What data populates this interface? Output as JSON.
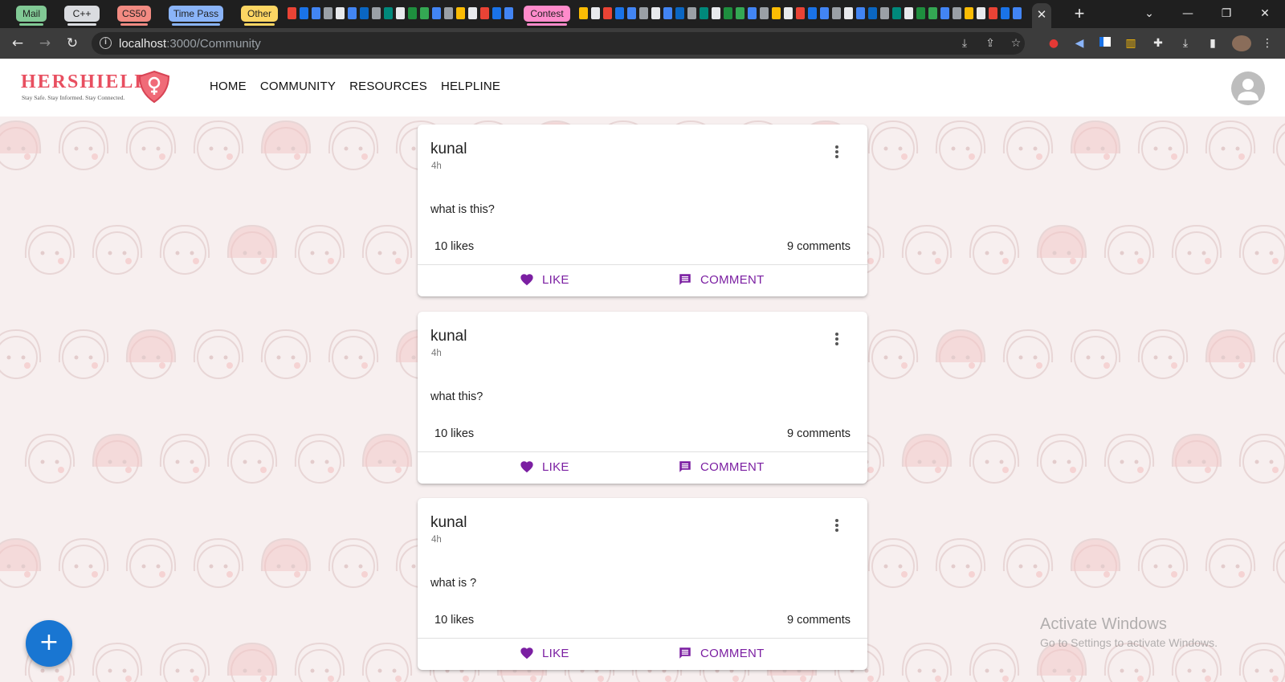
{
  "browser": {
    "tab_groups": [
      {
        "label": "Mail",
        "color": "#81c995"
      },
      {
        "label": "C++",
        "color": "#dadce0"
      },
      {
        "label": "CS50",
        "color": "#f28b82"
      },
      {
        "label": "Time Pass",
        "color": "#8ab4f8"
      },
      {
        "label": "Other",
        "color": "#fdd663"
      },
      {
        "label": "Contest",
        "color": "#ff8bcb"
      }
    ],
    "active_tab_close": "✕",
    "new_tab": "+",
    "url_host": "localhost",
    "url_path": ":3000/Community"
  },
  "app": {
    "brand": "HERSHIELD",
    "tagline": "Stay Safe. Stay Informed. Stay Connected.",
    "brand_color": "#e84f60",
    "nav": [
      "HOME",
      "COMMUNITY",
      "RESOURCES",
      "HELPLINE"
    ]
  },
  "posts": [
    {
      "author": "kunal",
      "time": "4h",
      "body": "what is this?",
      "likes": "10 likes",
      "comments": "9 comments",
      "like_label": "LIKE",
      "comment_label": "COMMENT"
    },
    {
      "author": "kunal",
      "time": "4h",
      "body": "what this?",
      "likes": "10 likes",
      "comments": "9 comments",
      "like_label": "LIKE",
      "comment_label": "COMMENT"
    },
    {
      "author": "kunal",
      "time": "4h",
      "body": "what is ?",
      "likes": "10 likes",
      "comments": "9 comments",
      "like_label": "LIKE",
      "comment_label": "COMMENT"
    }
  ],
  "action_color": "#7b1fa2",
  "fab": {
    "label": "+",
    "color": "#1976d2"
  },
  "watermark": {
    "title": "Activate Windows",
    "subtitle": "Go to Settings to activate Windows."
  }
}
